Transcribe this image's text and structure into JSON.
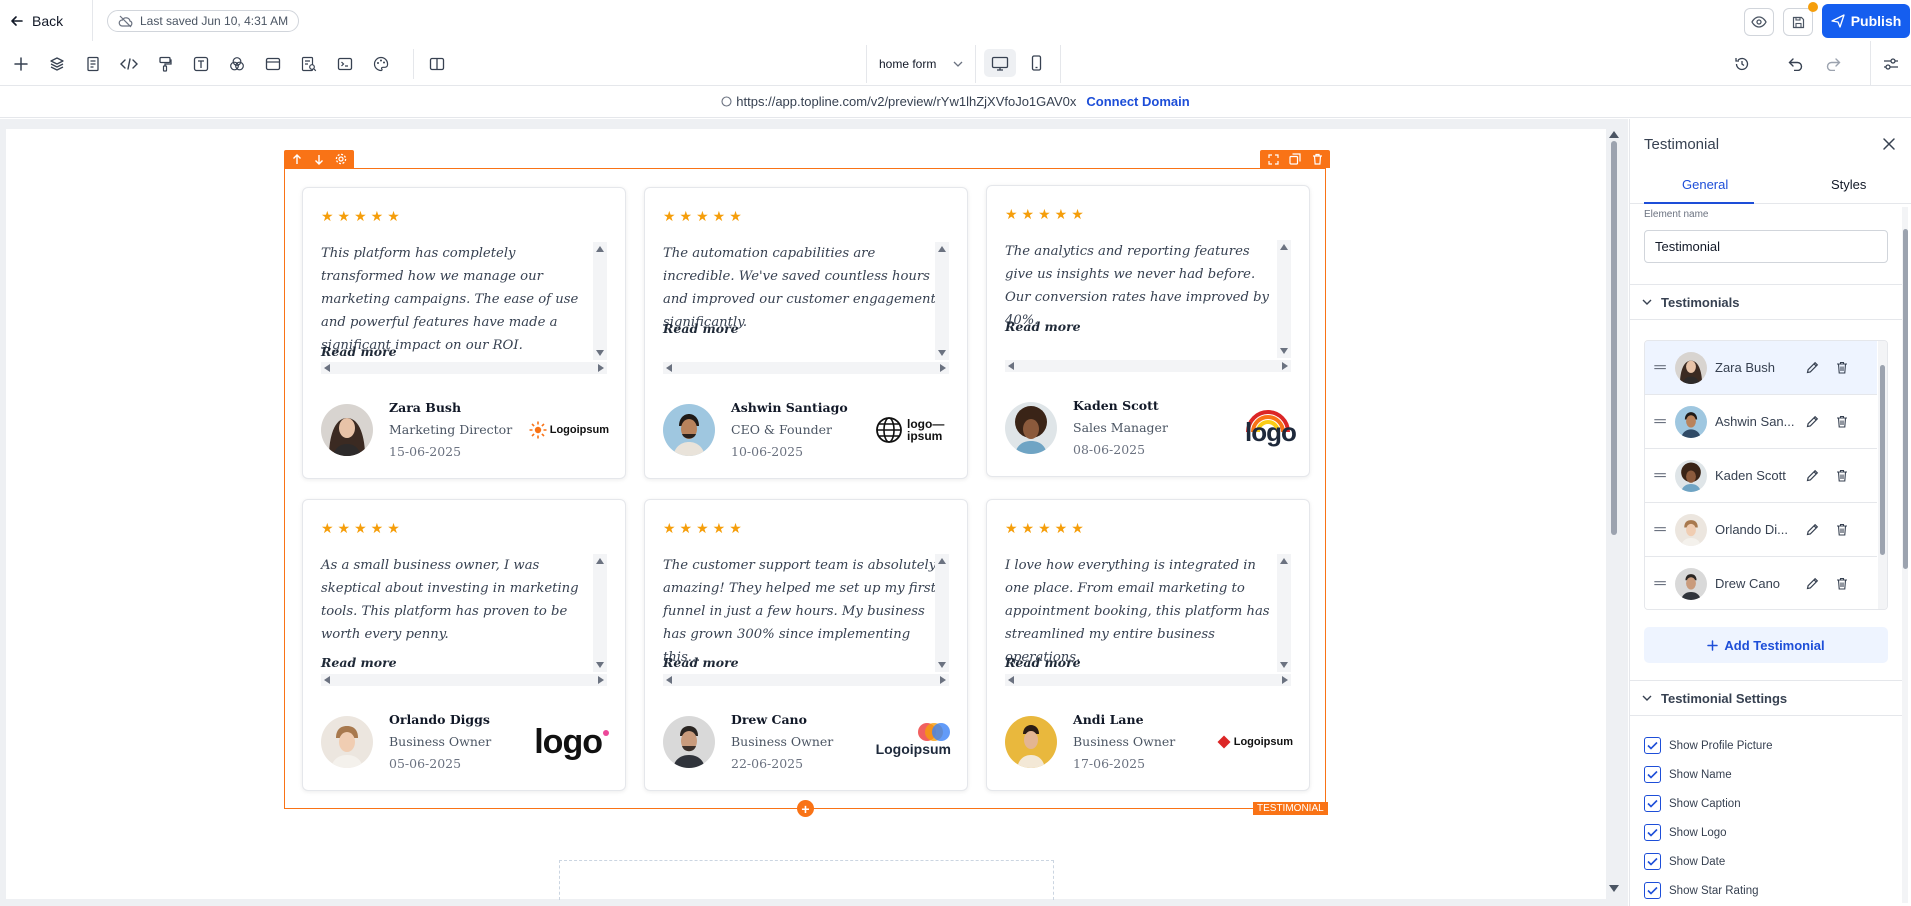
{
  "topbar": {
    "back_label": "Back",
    "last_saved": "Last saved Jun 10, 4:31 AM",
    "publish_label": "Publish"
  },
  "toolbar": {
    "page_name": "home form"
  },
  "urlbar": {
    "url": "https://app.topline.com/v2/preview/rYw1lhZjXVfoJo1GAV0x",
    "connect_label": "Connect Domain"
  },
  "canvas": {
    "element_label": "TESTIMONIAL"
  },
  "testimonials": [
    {
      "stars": "★★★★★",
      "quote": "This platform has completely transformed how we manage our marketing campaigns. The ease of use and powerful features have made a significant impact on our ROI.",
      "read_more": "Read more",
      "name": "Zara Bush",
      "role": "Marketing Director",
      "date": "15-06-2025",
      "logo_text": "Logoipsum"
    },
    {
      "stars": "★★★★★",
      "quote": "The automation capabilities are incredible. We've saved countless hours and improved our customer engagement significantly.",
      "read_more": "Read more",
      "name": "Ashwin Santiago",
      "role": "CEO & Founder",
      "date": "10-06-2025",
      "logo_text": "logo— ipsum"
    },
    {
      "stars": "★★★★★",
      "quote": "The analytics and reporting features give us insights we never had before. Our conversion rates have improved by 40%.",
      "read_more": "Read more",
      "name": "Kaden Scott",
      "role": "Sales Manager",
      "date": "08-06-2025",
      "logo_text": "logo"
    },
    {
      "stars": "★★★★★",
      "quote": "As a small business owner, I was skeptical about investing in marketing tools. This platform has proven to be worth every penny.",
      "read_more": "Read more",
      "name": "Orlando Diggs",
      "role": "Business Owner",
      "date": "05-06-2025",
      "logo_text": "logo"
    },
    {
      "stars": "★★★★★",
      "quote": "The customer support team is absolutely amazing! They helped me set up my first funnel in just a few hours. My business has grown 300% since implementing this...",
      "read_more": "Read more",
      "name": "Drew Cano",
      "role": "Business Owner",
      "date": "22-06-2025",
      "logo_text": "Logoipsum"
    },
    {
      "stars": "★★★★★",
      "quote": "I love how everything is integrated in one place. From email marketing to appointment booking, this platform has streamlined my entire business operations.",
      "read_more": "Read more",
      "name": "Andi Lane",
      "role": "Business Owner",
      "date": "17-06-2025",
      "logo_text": "Logoipsum"
    }
  ],
  "panel": {
    "title": "Testimonial",
    "tabs": [
      "General",
      "Styles"
    ],
    "element_name_label": "Element name",
    "element_name_value": "Testimonial",
    "testimonials_section": "Testimonials",
    "list": [
      "Zara Bush",
      "Ashwin San...",
      "Kaden Scott",
      "Orlando Di...",
      "Drew Cano"
    ],
    "add_label": "Add Testimonial",
    "settings_section": "Testimonial Settings",
    "settings": [
      "Show Profile Picture",
      "Show Name",
      "Show Caption",
      "Show Logo",
      "Show Date",
      "Show Star Rating"
    ]
  },
  "colors": {
    "accent": "#155eef",
    "selection": "#f97316",
    "star": "#f59e0b"
  },
  "icons": {
    "back": "arrow-left-icon",
    "cloud_off": "cloud-off-icon",
    "preview": "eye-icon",
    "save": "save-icon",
    "publish": "send-icon",
    "history": "history-icon",
    "undo": "undo-icon",
    "redo": "redo-icon",
    "settings": "sliders-icon",
    "drag": "drag-handle-icon",
    "edit": "pencil-icon",
    "delete": "trash-icon"
  }
}
